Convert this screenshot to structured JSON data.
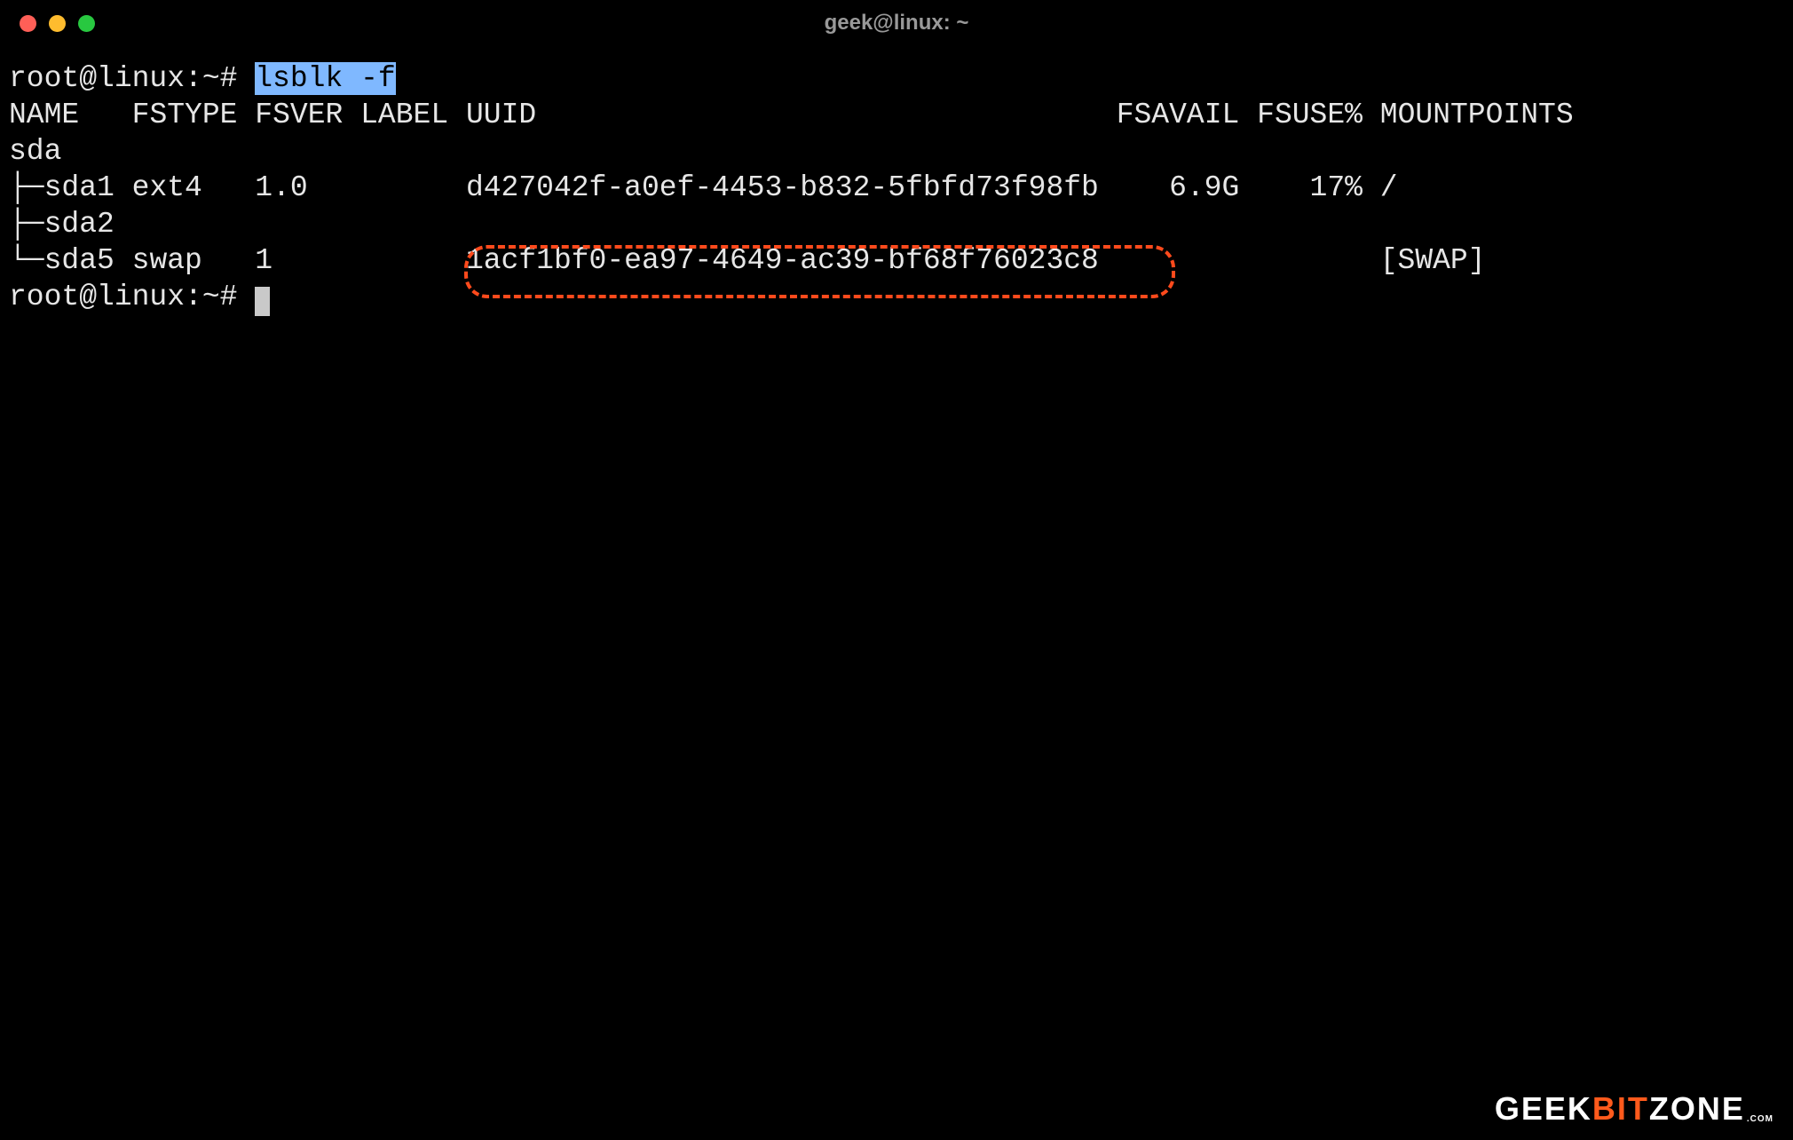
{
  "window": {
    "title": "geek@linux: ~"
  },
  "prompt": {
    "text": "root@linux:~# ",
    "command": "lsblk -f"
  },
  "header": {
    "name": "NAME",
    "fstype": "FSTYPE",
    "fsver": "FSVER",
    "label": "LABEL",
    "uuid": "UUID",
    "fsavail": "FSAVAIL",
    "fsuse": "FSUSE%",
    "mountpoints": "MOUNTPOINTS"
  },
  "rows": {
    "sda": {
      "name": "sda"
    },
    "sda1": {
      "name": "├─sda1",
      "fstype": "ext4",
      "fsver": "1.0",
      "label": "",
      "uuid": "d427042f-a0ef-4453-b832-5fbfd73f98fb",
      "fsavail": "6.9G",
      "fsuse": "17%",
      "mountpoints": "/"
    },
    "sda2": {
      "name": "├─sda2"
    },
    "sda5": {
      "name": "└─sda5",
      "fstype": "swap",
      "fsver": "1",
      "label": "",
      "uuid": "1acf1bf0-ea97-4649-ac39-bf68f76023c8",
      "fsavail": "",
      "fsuse": "",
      "mountpoints": "[SWAP]"
    }
  },
  "prompt2": {
    "text": "root@linux:~# "
  },
  "highlight": {
    "target_uuid": "1acf1bf0-ea97-4649-ac39-bf68f76023c8"
  },
  "watermark": {
    "part1": "GEEK",
    "part2": "BIT",
    "part3": "ZONE",
    "suffix": ".COM"
  }
}
